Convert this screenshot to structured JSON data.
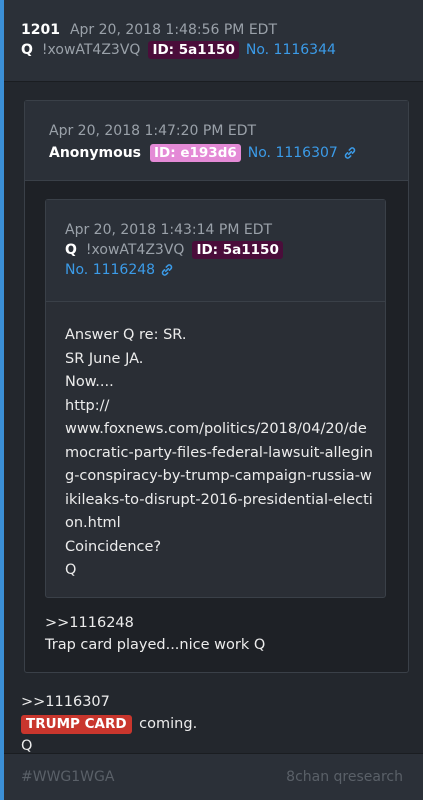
{
  "post": {
    "number": "1201",
    "date": "Apr 20, 2018 1:48:56 PM EDT",
    "author": "Q",
    "tripcode": "!xowAT4Z3VQ",
    "id_label": "ID: 5a1150",
    "post_no": "No. 1116344",
    "colors": {
      "accent": "#3b8fd6",
      "id_badge": "#4a0d3a"
    }
  },
  "quoted": {
    "date": "Apr 20, 2018 1:47:20 PM EDT",
    "author": "Anonymous",
    "id_label": "ID: e193d6",
    "post_no": "No. 1116307",
    "icon": "link-icon",
    "inner": {
      "date": "Apr 20, 2018 1:43:14 PM EDT",
      "author": "Q",
      "tripcode": "!xowAT4Z3VQ",
      "id_label": "ID: 5a1150",
      "post_no": "No. 1116248",
      "icon": "link-icon",
      "lines": [
        "Answer Q re: SR.",
        "SR June JA.",
        "Now....",
        "http://",
        "www.foxnews.com/politics/2018/04/20/democratic-party-files-federal-lawsuit-alleging-conspiracy-by-trump-campaign-russia-wikileaks-to-disrupt-2016-presidential-election.html",
        "Coincidence?",
        "Q"
      ]
    },
    "reply_lines": [
      ">>1116248",
      "Trap card played...nice work Q"
    ]
  },
  "main": {
    "ref": ">>1116307",
    "badge": "TRUMP CARD",
    "badge_rest": " coming.",
    "sign": "Q"
  },
  "footer": {
    "hashtag": "#WWG1WGA",
    "source": "8chan qresearch"
  }
}
